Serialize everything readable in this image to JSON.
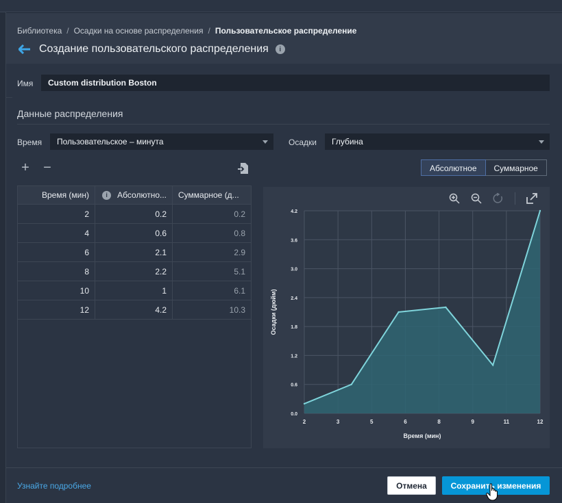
{
  "breadcrumb": {
    "items": [
      "Библиотека",
      "Осадки на основе распределения"
    ],
    "separator": "/",
    "current": "Пользовательское распределение"
  },
  "title": "Создание пользовательского распределения",
  "name_field": {
    "label": "Имя",
    "value": "Custom distribution Boston"
  },
  "section_title": "Данные распределения",
  "time_field": {
    "label": "Время",
    "value": "Пользовательское – минута"
  },
  "precip_field": {
    "label": "Осадки",
    "value": "Глубина"
  },
  "toggle": {
    "absolute": "Абсолютное",
    "cumulative": "Суммарное",
    "selected": "absolute"
  },
  "table": {
    "headers": [
      "Время (мин)",
      "Абсолютно...",
      "Суммарное (д..."
    ],
    "rows": [
      [
        "2",
        "0.2",
        "0.2"
      ],
      [
        "4",
        "0.6",
        "0.8"
      ],
      [
        "6",
        "2.1",
        "2.9"
      ],
      [
        "8",
        "2.2",
        "5.1"
      ],
      [
        "10",
        "1",
        "6.1"
      ],
      [
        "12",
        "4.2",
        "10.3"
      ]
    ]
  },
  "chart_data": {
    "type": "area",
    "x_ticks": [
      "2",
      "3",
      "5",
      "6",
      "8",
      "9",
      "11",
      "12"
    ],
    "y_ticks": [
      "0.0",
      "0.6",
      "1.2",
      "1.8",
      "2.4",
      "3.0",
      "3.6",
      "4.2"
    ],
    "xlabel": "Время (мин)",
    "ylabel": "Осадки (дюйм)",
    "x": [
      2,
      4,
      6,
      8,
      10,
      12
    ],
    "y": [
      0.2,
      0.6,
      2.1,
      2.2,
      1,
      4.2
    ],
    "xlim": [
      2,
      12
    ],
    "ylim": [
      0,
      4.2
    ],
    "grid": true,
    "line_color": "#7fd4db",
    "fill_color": "#2f6572"
  },
  "footer": {
    "learn_more": "Узнайте подробнее",
    "cancel": "Отмена",
    "save": "Сохранить изменения"
  },
  "colors": {
    "accent": "#0696d7",
    "link": "#4aa8e6",
    "back_arrow": "#3ea6e6"
  }
}
